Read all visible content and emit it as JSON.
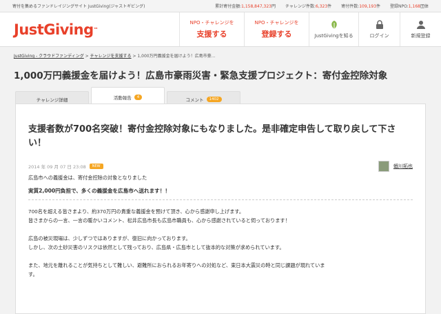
{
  "topbar": {
    "tagline": "寄付を集めるファンドレイジングサイト JustGiving(ジャストギビング)",
    "stats": [
      {
        "label": "累計寄付金額:",
        "value": "1,158,847,323",
        "unit": "円"
      },
      {
        "label": "チャレンジ件数:",
        "value": "6,323",
        "unit": "件"
      },
      {
        "label": "寄付件数:",
        "value": "109,193",
        "unit": "件"
      },
      {
        "label": "登録NPO:",
        "value": "1,168",
        "unit": "団体"
      }
    ]
  },
  "header": {
    "logo": "JustGiving",
    "logo_tm": "™",
    "cta": [
      {
        "small": "NPO・チャレンジを",
        "big": "支援する"
      },
      {
        "small": "NPO・チャレンジを",
        "big": "登録する"
      }
    ],
    "icons": [
      {
        "label": "JustGivingを知る"
      },
      {
        "label": "ログイン"
      },
      {
        "label": "新規登録"
      }
    ]
  },
  "breadcrumb": {
    "home": "JustGiving - クラウドファンディング",
    "sep": " > ",
    "level2": "チャレンジを支援する",
    "current": "1,000万円義援金を届けよう！広島市豪..."
  },
  "page_title": "1,000万円義援金を届けよう！広島市豪雨災害・緊急支援プロジェクト：寄付金控除対象",
  "tabs": [
    {
      "label": "チャレンジ詳細",
      "badge": ""
    },
    {
      "label": "活動報告",
      "badge": "4"
    },
    {
      "label": "コメント",
      "badge": "1402"
    }
  ],
  "post": {
    "title": "支援者数が700名突破！寄付金控除対象にもなりました。是非確定申告して取り戻して下さい！",
    "date": "2014 年 09 月 07 日 23:08",
    "new_label": "NEW",
    "author": "蝦川拓也",
    "lines": [
      "広島市への義援金は、寄付金控除の対象となりました",
      "実質2,000円負担で、多くの義援金を広島市へ送れます！！",
      "700名を超える皆さまより、約370万円の貴重な義援金を預けて頂き、心から感謝申し上げます。",
      "皆さまからの一言、一言の暖かいコメント、松井広島市長も広島市職員も、心から感謝されていると伺っております！",
      "広島の被災現場は、少しずつではありますが、復旧に向かっております。",
      "しかし、次の土砂災害のリスクは依然として残っており、広島県・広島市として抜本的な対策が求められています。",
      "また、地元を離れることが気持ちとして難しい、避難所におられるお年寄りへの対処など、東日本大震災の時と同じ課題が現れていま",
      "す。"
    ]
  },
  "colors": {
    "accent": "#e8402a",
    "badge": "#f5a623"
  }
}
